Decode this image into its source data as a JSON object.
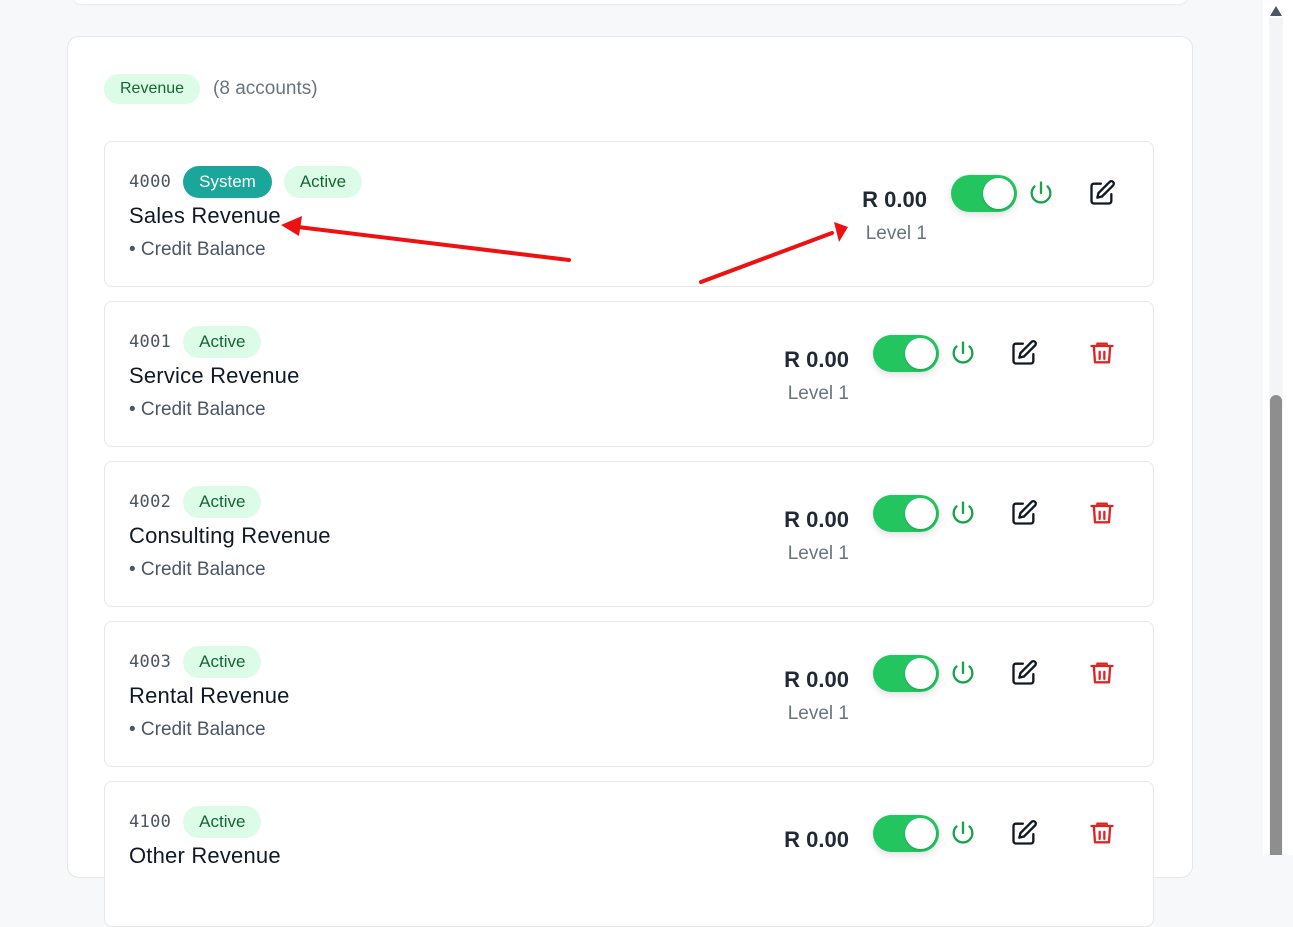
{
  "group": {
    "badge": "Revenue",
    "count": "(8 accounts)"
  },
  "accounts": [
    {
      "code": "4000",
      "system_badge": "System",
      "status": "Active",
      "name": "Sales Revenue",
      "balance_type": "• Credit Balance",
      "balance": "R 0.00",
      "level": "Level 1",
      "enabled": true
    },
    {
      "code": "4001",
      "status": "Active",
      "name": "Service Revenue",
      "balance_type": "• Credit Balance",
      "balance": "R 0.00",
      "level": "Level 1",
      "enabled": true
    },
    {
      "code": "4002",
      "status": "Active",
      "name": "Consulting Revenue",
      "balance_type": "• Credit Balance",
      "balance": "R 0.00",
      "level": "Level 1",
      "enabled": true
    },
    {
      "code": "4003",
      "status": "Active",
      "name": "Rental Revenue",
      "balance_type": "• Credit Balance",
      "balance": "R 0.00",
      "level": "Level 1",
      "enabled": true
    },
    {
      "code": "4100",
      "status": "Active",
      "name": "Other Revenue",
      "balance": "R 0.00",
      "enabled": true
    }
  ],
  "colors": {
    "toggle_on": "#22c55e",
    "system_badge": "#1aa69a",
    "active_badge_bg": "#dcfce7",
    "active_badge_text": "#166534",
    "delete_icon": "#dc2626",
    "power_icon": "#16a34a",
    "annotation_arrow": "#ee1111"
  },
  "icons": {
    "power": "power-icon",
    "edit": "edit-icon",
    "delete": "trash-icon"
  }
}
